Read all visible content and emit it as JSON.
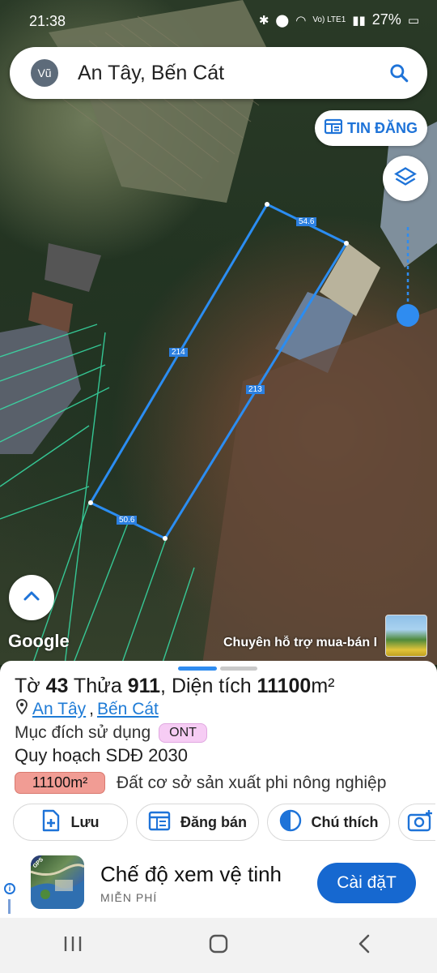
{
  "status_bar": {
    "time": "21:38",
    "battery": "27%",
    "network": "Vo) LTE1"
  },
  "search": {
    "avatar_initials": "Vũ",
    "query": "An Tây, Bến Cát"
  },
  "map": {
    "post_button_label": "TIN ĐĂNG",
    "google_label": "Google",
    "banner_text": "Chuyên hỗ trợ mua-bán I",
    "parcel_edges": {
      "top": "54.6",
      "left": "214",
      "right": "213",
      "bottom": "50.6"
    }
  },
  "parcel": {
    "title_prefix": "Tờ ",
    "sheet_no": "43",
    "title_mid": " Thửa ",
    "lot_no": "911",
    "title_area_prefix": ", Diện tích ",
    "area": "11100",
    "area_unit": "m²",
    "ward": "An Tây",
    "separator": ", ",
    "district": "Bến Cát",
    "purpose_label": "Mục đích sử dụng",
    "purpose_code": "ONT",
    "plan_label": "Quy hoạch SDĐ 2030",
    "plan_area": "11100m²",
    "plan_desc": "Đất cơ sở sản xuất phi nông nghiệp",
    "colors": {
      "plan_badge": "#f19c94",
      "purpose_badge": "#f6ccf4"
    }
  },
  "actions": [
    {
      "label": "Lưu",
      "icon": "add-file-icon"
    },
    {
      "label": "Đăng bán",
      "icon": "calendar-icon"
    },
    {
      "label": "Chú thích",
      "icon": "half-circle-icon"
    },
    {
      "label": "",
      "icon": "add-photo-icon"
    }
  ],
  "ad": {
    "title": "Chế độ xem vệ tinh",
    "subtitle": "MIỄN PHÍ",
    "button": "Cài đặT",
    "icon_badge": "GPS"
  },
  "accent_color": "#1e73d8"
}
